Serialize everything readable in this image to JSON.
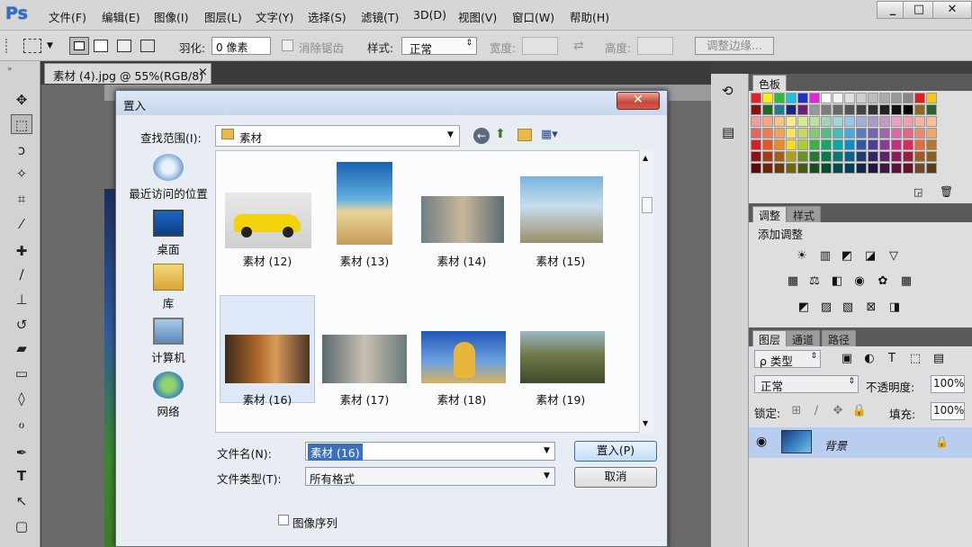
{
  "app": {
    "logo": "Ps"
  },
  "menubar": {
    "items": [
      "文件(F)",
      "编辑(E)",
      "图像(I)",
      "图层(L)",
      "文字(Y)",
      "选择(S)",
      "滤镜(T)",
      "3D(D)",
      "视图(V)",
      "窗口(W)",
      "帮助(H)"
    ],
    "window_controls": [
      "_",
      "□",
      "✕"
    ]
  },
  "optionsbar": {
    "feather_label": "羽化:",
    "feather_value": "0 像素",
    "antialias_label": "消除锯齿",
    "style_label": "样式:",
    "style_value": "正常",
    "width_label": "宽度:",
    "height_label": "高度:",
    "refine_edge_label": "调整边缘..."
  },
  "document": {
    "tab_title": "素材 (4).jpg @ 55%(RGB/8)",
    "tab_close": "×"
  },
  "panels": {
    "swatches_tab": "色板",
    "adjust_tab": "调整",
    "styles_tab": "样式",
    "add_adjustment": "添加调整",
    "layers_tab": "图层",
    "channels_tab": "通道",
    "paths_tab": "路径",
    "kind_filter": "ρ 类型",
    "blend_mode": "正常",
    "opacity_label": "不透明度:",
    "opacity_value": "100%",
    "lock_label": "锁定:",
    "fill_label": "填充:",
    "fill_value": "100%",
    "layer_name": "背景"
  },
  "dialog": {
    "title": "置入",
    "close": "✕",
    "lookin_label": "查找范围(I):",
    "lookin_value": "素材",
    "places": [
      "最近访问的位置",
      "桌面",
      "库",
      "计算机",
      "网络"
    ],
    "files": [
      "素材 (12)",
      "素材 (13)",
      "素材 (14)",
      "素材 (15)",
      "素材 (16)",
      "素材 (17)",
      "素材 (18)",
      "素材 (19)"
    ],
    "filename_label": "文件名(N):",
    "filename_value": "素材 (16)",
    "filetype_label": "文件类型(T):",
    "filetype_value": "所有格式",
    "place_button": "置入(P)",
    "cancel_button": "取消",
    "image_sequence": "图像序列"
  },
  "colors": {
    "ps_blue": "#2d6fc7",
    "dialog_bg": "#e8edf4",
    "close_red": "#c7473a",
    "selected_row": "#b9cdf0"
  },
  "swatch_colors": [
    "#e61e28",
    "#f7ec1c",
    "#2ebd3b",
    "#1fc0d8",
    "#2130c4",
    "#e127d4",
    "#ffffff",
    "#f3f3f3",
    "#e0e0e0",
    "#cfcfcf",
    "#bcbcbc",
    "#aaaaaa",
    "#989898",
    "#878787",
    "#dd1c24",
    "#f2c719",
    "#8c0f12",
    "#1c6a24",
    "#1f7b97",
    "#1a2680",
    "#6c1e72",
    "#98989c",
    "#7c7c7c",
    "#676767",
    "#555555",
    "#444444",
    "#333333",
    "#222222",
    "#111111",
    "#000000",
    "#8a6b1f",
    "#2d5f34",
    "#ee9da0",
    "#f4a585",
    "#f6c585",
    "#fbe98a",
    "#d8e98e",
    "#bde0a1",
    "#9ed6b2",
    "#9fd8d4",
    "#96c7e6",
    "#9fb0da",
    "#a79ccc",
    "#c29bc8",
    "#e8a1c8",
    "#ee9fb0",
    "#f8b2a2",
    "#f6c19a",
    "#e9625f",
    "#ee7a53",
    "#f3a359",
    "#f9e35e",
    "#c0dc5e",
    "#84cb70",
    "#4fbc8a",
    "#44bdb8",
    "#45a9dc",
    "#5d7bc2",
    "#7467b0",
    "#a164ae",
    "#da68a6",
    "#e86486",
    "#ec8a6b",
    "#f0a76a",
    "#d62026",
    "#e6541f",
    "#ee8a23",
    "#f6db24",
    "#a8cf2a",
    "#3eb049",
    "#14a46c",
    "#06a8a4",
    "#0a8fd0",
    "#2e5aa8",
    "#513b96",
    "#893c97",
    "#cb2b84",
    "#dc275b",
    "#e46b3e",
    "#b4762c",
    "#921115",
    "#a43c12",
    "#a85e12",
    "#b0a11a",
    "#6e9021",
    "#237832",
    "#087a4d",
    "#077877",
    "#07628f",
    "#1f3c77",
    "#372468",
    "#5e2668",
    "#8f1b5d",
    "#9b1b41",
    "#a25a22",
    "#85621e",
    "#5b0b0d",
    "#6e240a",
    "#6b3b0b",
    "#6f660e",
    "#445c13",
    "#174d20",
    "#064d31",
    "#054c4b",
    "#053e5c",
    "#12264c",
    "#221742",
    "#3b1842",
    "#5a113a",
    "#631029",
    "#6f4a25",
    "#5a3d1a"
  ]
}
